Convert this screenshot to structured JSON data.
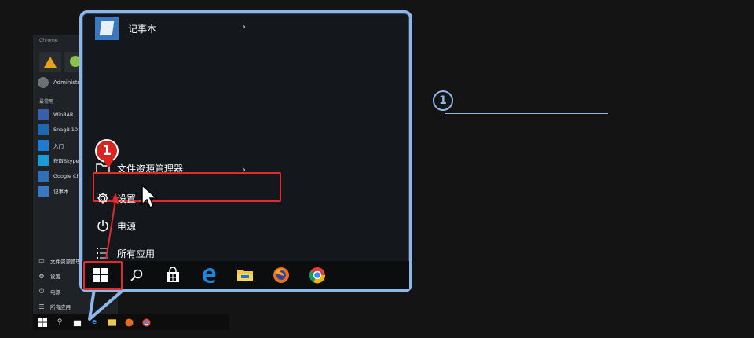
{
  "background_menu": {
    "top_label": "Chrome",
    "user_name": "Administrator",
    "frequent_label": "最常用",
    "apps": [
      {
        "label": "WinRAR",
        "color": "#3a5fa8"
      },
      {
        "label": "Snagit 10",
        "color": "#1d6ab0"
      },
      {
        "label": "入门",
        "color": "#1f7ad1"
      },
      {
        "label": "获取Skype",
        "color": "#1d9ad6"
      },
      {
        "label": "Google Chrome",
        "color": "#2f6fb5"
      },
      {
        "label": "记事本",
        "color": "#3a78c2"
      }
    ],
    "bottom_items": [
      {
        "label": "文件资源管理器",
        "icon": "folder-icon"
      },
      {
        "label": "设置",
        "icon": "gear-icon"
      },
      {
        "label": "电源",
        "icon": "power-icon"
      },
      {
        "label": "所有应用",
        "icon": "list-icon"
      }
    ]
  },
  "callout": {
    "notepad_label": "记事本",
    "explorer_label": "文件资源管理器",
    "settings_label": "设置",
    "power_label": "电源",
    "all_apps_label": "所有应用",
    "taskbar_icons": [
      "windows-start-icon",
      "search-icon",
      "store-icon",
      "edge-icon",
      "file-explorer-icon",
      "firefox-icon",
      "chrome-icon"
    ]
  },
  "annotations": {
    "step_badge": "1",
    "right_badge": "1",
    "right_note": ""
  },
  "colors": {
    "highlight_red": "#e02b2b",
    "callout_border": "#8eb6e6",
    "background": "#141414"
  }
}
